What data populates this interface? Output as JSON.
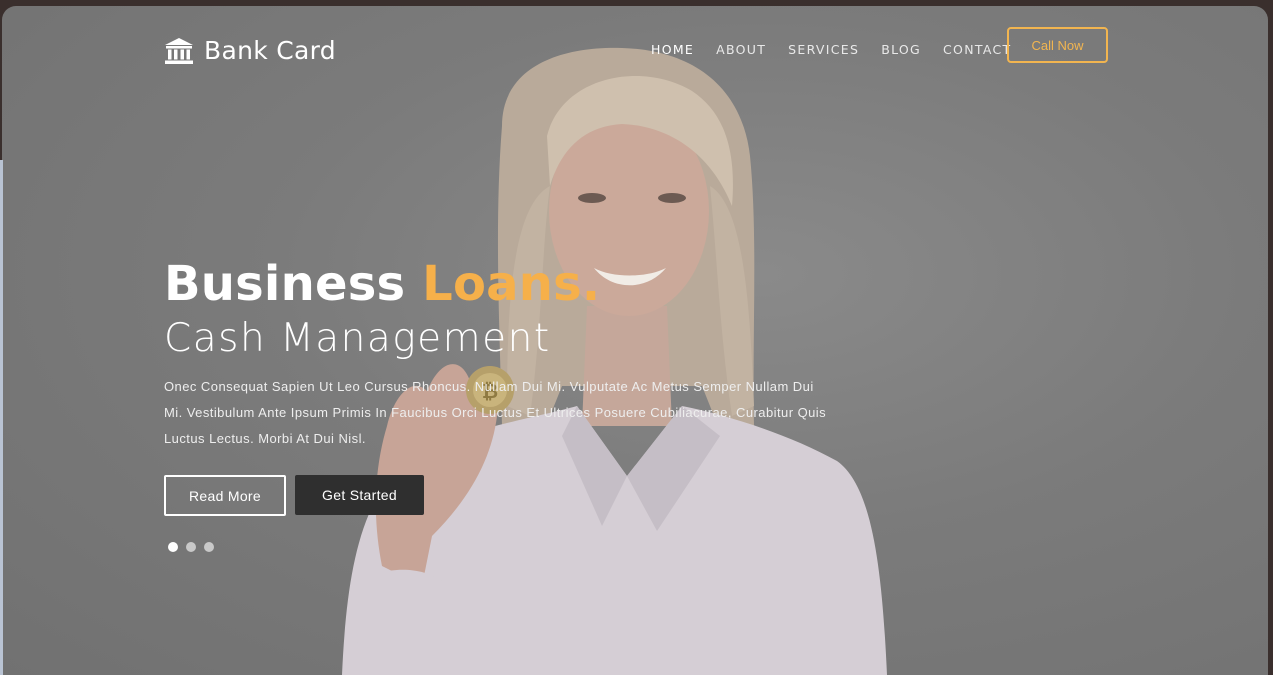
{
  "brand": {
    "name": "Bank Card",
    "icon": "bank-icon"
  },
  "nav": {
    "items": [
      {
        "label": "HOME",
        "active": true
      },
      {
        "label": "ABOUT",
        "active": false
      },
      {
        "label": "SERVICES",
        "active": false
      },
      {
        "label": "BLOG",
        "active": false
      },
      {
        "label": "CONTACT",
        "active": false
      }
    ],
    "cta_label": "Call Now"
  },
  "hero": {
    "title_main": "Business",
    "title_accent": "Loans.",
    "subtitle": "Cash Management",
    "description": "Onec Consequat Sapien Ut Leo Cursus Rhoncus. Nullam Dui Mi. Vulputate Ac Metus Semper Nullam Dui Mi. Vestibulum Ante Ipsum Primis In Faucibus Orci Luctus Et Ultrices Posuere Cubiliacurae, Curabitur Quis Luctus Lectus. Morbi At Dui Nisl.",
    "read_more_label": "Read More",
    "get_started_label": "Get Started"
  },
  "slider": {
    "dot_count": 3,
    "active_index": 0
  },
  "colors": {
    "accent": "#f6b04a",
    "overlay": "#7b7b7b",
    "dark_button": "#2f2f2f"
  }
}
